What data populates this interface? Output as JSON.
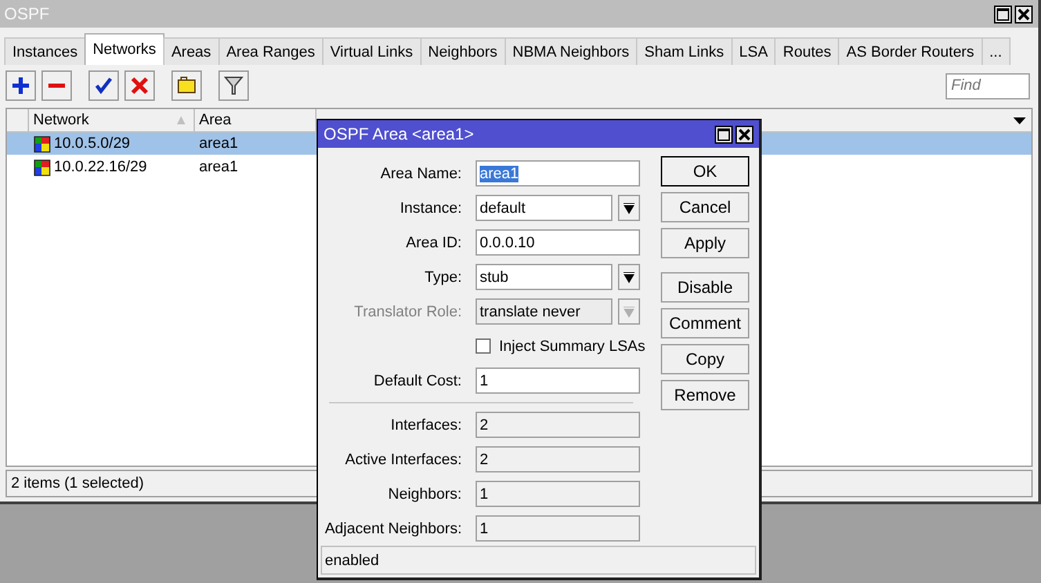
{
  "window": {
    "title": "OSPF"
  },
  "tabs": [
    {
      "label": "Instances",
      "selected": false
    },
    {
      "label": "Networks",
      "selected": true
    },
    {
      "label": "Areas",
      "selected": false
    },
    {
      "label": "Area Ranges",
      "selected": false
    },
    {
      "label": "Virtual Links",
      "selected": false
    },
    {
      "label": "Neighbors",
      "selected": false
    },
    {
      "label": "NBMA Neighbors",
      "selected": false
    },
    {
      "label": "Sham Links",
      "selected": false
    },
    {
      "label": "LSA",
      "selected": false
    },
    {
      "label": "Routes",
      "selected": false
    },
    {
      "label": "AS Border Routers",
      "selected": false
    },
    {
      "label": "...",
      "selected": false
    }
  ],
  "search": {
    "placeholder": "Find"
  },
  "table": {
    "columns": [
      "Network",
      "Area"
    ],
    "rows": [
      {
        "network": "10.0.5.0/29",
        "area": "area1",
        "selected": true
      },
      {
        "network": "10.0.22.16/29",
        "area": "area1",
        "selected": false
      }
    ]
  },
  "status_bar": "2 items (1 selected)",
  "dialog": {
    "title": "OSPF Area <area1>",
    "fields": [
      {
        "kind": "text",
        "label": "Area Name:",
        "value": "area1",
        "value_selected": true,
        "disabled": false
      },
      {
        "kind": "select",
        "label": "Instance:",
        "value": "default",
        "disabled": false
      },
      {
        "kind": "text",
        "label": "Area ID:",
        "value": "0.0.0.10",
        "value_selected": false,
        "disabled": false
      },
      {
        "kind": "select",
        "label": "Type:",
        "value": "stub",
        "disabled": false
      },
      {
        "kind": "select",
        "label": "Translator Role:",
        "value": "translate never",
        "disabled": true
      },
      {
        "kind": "checkbox",
        "label": "Inject Summary LSAs",
        "checked": false,
        "disabled": false
      },
      {
        "kind": "text",
        "label": "Default Cost:",
        "value": "1",
        "value_selected": false,
        "disabled": false
      },
      {
        "kind": "separator"
      },
      {
        "kind": "readonly",
        "label": "Interfaces:",
        "value": "2"
      },
      {
        "kind": "readonly",
        "label": "Active Interfaces:",
        "value": "2"
      },
      {
        "kind": "readonly",
        "label": "Neighbors:",
        "value": "1"
      },
      {
        "kind": "readonly",
        "label": "Adjacent Neighbors:",
        "value": "1"
      }
    ],
    "buttons": [
      {
        "label": "OK",
        "kind": "default"
      },
      {
        "label": "Cancel",
        "kind": "normal"
      },
      {
        "label": "Apply",
        "kind": "normal"
      },
      {
        "label": "Disable",
        "kind": "group"
      },
      {
        "label": "Comment",
        "kind": "normal"
      },
      {
        "label": "Copy",
        "kind": "normal"
      },
      {
        "label": "Remove",
        "kind": "normal"
      }
    ],
    "status": "enabled"
  }
}
